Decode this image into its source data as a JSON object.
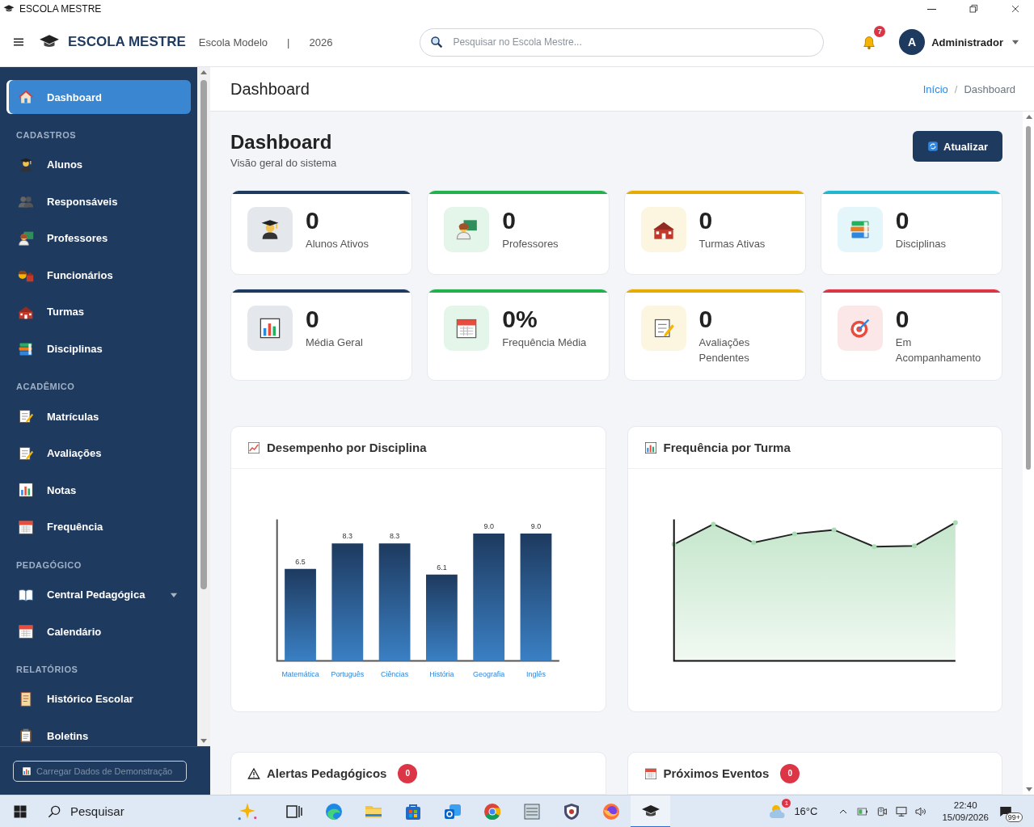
{
  "window": {
    "title": "ESCOLA MESTRE"
  },
  "header": {
    "brand": "ESCOLA MESTRE",
    "school": "Escola Modelo",
    "separator": "|",
    "year": "2026",
    "search": {
      "placeholder": "Pesquisar no Escola Mestre..."
    },
    "notifications": "7",
    "user": {
      "initial": "A",
      "name": "Administrador"
    }
  },
  "sidebar": {
    "items": [
      {
        "kind": "item",
        "label": "Dashboard",
        "selected": true
      },
      {
        "kind": "section",
        "label": "CADASTROS"
      },
      {
        "kind": "item",
        "label": "Alunos",
        "selected": false
      },
      {
        "kind": "item",
        "label": "Responsáveis",
        "selected": false
      },
      {
        "kind": "item",
        "label": "Professores",
        "selected": false
      },
      {
        "kind": "item",
        "label": "Funcionários",
        "selected": false
      },
      {
        "kind": "item",
        "label": "Turmas",
        "selected": false
      },
      {
        "kind": "item",
        "label": "Disciplinas",
        "selected": false
      },
      {
        "kind": "section",
        "label": "ACADÊMICO"
      },
      {
        "kind": "item",
        "label": "Matrículas",
        "selected": false
      },
      {
        "kind": "item",
        "label": "Avaliações",
        "selected": false
      },
      {
        "kind": "item",
        "label": "Notas",
        "selected": false
      },
      {
        "kind": "item",
        "label": "Frequência",
        "selected": false
      },
      {
        "kind": "section",
        "label": "PEDAGÓGICO"
      },
      {
        "kind": "item",
        "label": "Central Pedagógica",
        "selected": false,
        "expanded": false
      },
      {
        "kind": "item",
        "label": "Calendário",
        "selected": false
      },
      {
        "kind": "section",
        "label": "RELATÓRIOS"
      },
      {
        "kind": "item",
        "label": "Histórico Escolar",
        "selected": false
      },
      {
        "kind": "item",
        "label": "Boletins",
        "selected": false
      }
    ],
    "demo_button": "Carregar Dados de Demonstração"
  },
  "breadcrumb": {
    "title": "Dashboard",
    "separator": "/",
    "items": [
      "Início",
      "Dashboard"
    ]
  },
  "page": {
    "title": "Dashboard",
    "subtitle": "Visão geral do sistema",
    "refresh_button": "Atualizar"
  },
  "stats": [
    {
      "value": "0",
      "label": "Alunos Ativos",
      "color": "#1e3a5f"
    },
    {
      "value": "0",
      "label": "Professores",
      "color": "#22b14c"
    },
    {
      "value": "0",
      "label": "Turmas Ativas",
      "color": "#e6ac00"
    },
    {
      "value": "0",
      "label": "Disciplinas",
      "color": "#1fb8cf"
    },
    {
      "value": "0",
      "label": "Média Geral",
      "color": "#1e3a5f"
    },
    {
      "value": "0%",
      "label": "Frequência Média",
      "color": "#22b14c"
    },
    {
      "value": "0",
      "label": "Avaliações Pendentes",
      "color": "#e6ac00"
    },
    {
      "value": "0",
      "label": "Em Acompanhamento",
      "color": "#dc3545"
    }
  ],
  "panels": [
    {
      "title": "Desempenho por Disciplina",
      "chart_data": {
        "type": "bar",
        "categories": [
          "Matemática",
          "Português",
          "Ciências",
          "História",
          "Geografia",
          "Inglês"
        ],
        "values": [
          6.5,
          8.3,
          8.3,
          6.1,
          9.0,
          9.0
        ],
        "ylim": [
          0,
          10
        ],
        "value_labels": [
          "6.5",
          "8.3",
          "8.3",
          "6.1",
          "9.0",
          "9.0"
        ]
      }
    },
    {
      "title": "Frequência por Turma"
    }
  ],
  "bottom_panels": [
    {
      "title": "Alertas Pedagógicos",
      "count": "0"
    },
    {
      "title": "Próximos Eventos",
      "count": "0"
    }
  ],
  "taskbar": {
    "search": "Pesquisar",
    "weather_badge": "1",
    "temperature": "16°C",
    "time": "22:40",
    "date": "15/09/2026",
    "notification_count": "99+"
  }
}
